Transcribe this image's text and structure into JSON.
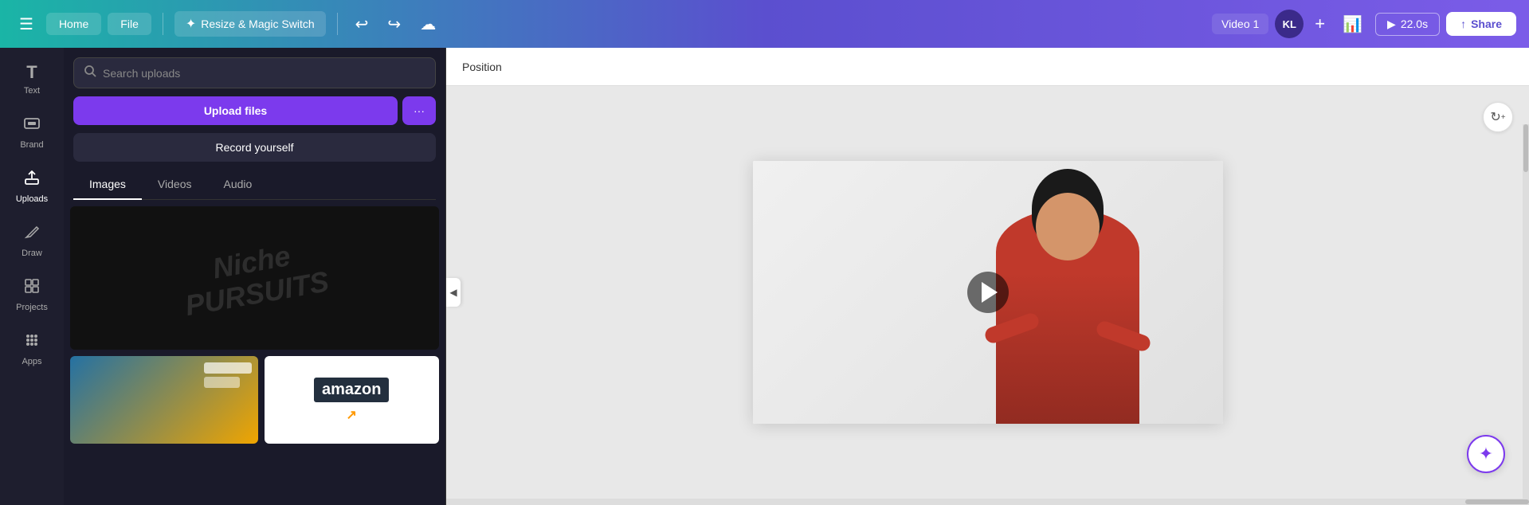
{
  "topNav": {
    "menuIcon": "☰",
    "homeLabel": "Home",
    "fileLabel": "File",
    "magicSwitchLabel": "Resize & Magic Switch",
    "magicSwitchIcon": "✦",
    "undoIcon": "↩",
    "redoIcon": "↪",
    "cloudIcon": "☁",
    "videoTitle": "Video 1",
    "avatarInitials": "KL",
    "plusIcon": "+",
    "statsIcon": "📊",
    "playIcon": "▶",
    "playDuration": "22.0s",
    "shareIcon": "↑",
    "shareLabel": "Share"
  },
  "sidebar": {
    "items": [
      {
        "id": "text",
        "icon": "T",
        "label": "Text"
      },
      {
        "id": "brand",
        "icon": "🏷",
        "label": "Brand"
      },
      {
        "id": "uploads",
        "icon": "⬆",
        "label": "Uploads"
      },
      {
        "id": "draw",
        "icon": "✏",
        "label": "Draw"
      },
      {
        "id": "projects",
        "icon": "▦",
        "label": "Projects"
      },
      {
        "id": "apps",
        "icon": "⚏",
        "label": "Apps"
      }
    ]
  },
  "uploadPanel": {
    "searchPlaceholder": "Search uploads",
    "uploadFilesLabel": "Upload files",
    "uploadMoreIcon": "···",
    "recordLabel": "Record yourself",
    "tabs": [
      {
        "id": "images",
        "label": "Images",
        "active": true
      },
      {
        "id": "videos",
        "label": "Videos",
        "active": false
      },
      {
        "id": "audio",
        "label": "Audio",
        "active": false
      }
    ],
    "watermarkText1": "Niche",
    "watermarkText2": "PURSUITS"
  },
  "positionBar": {
    "label": "Position"
  },
  "canvas": {
    "rotatePlusIcon": "↻+",
    "collapseIcon": "◀",
    "magicIcon": "✦",
    "playIcon": "▶"
  }
}
